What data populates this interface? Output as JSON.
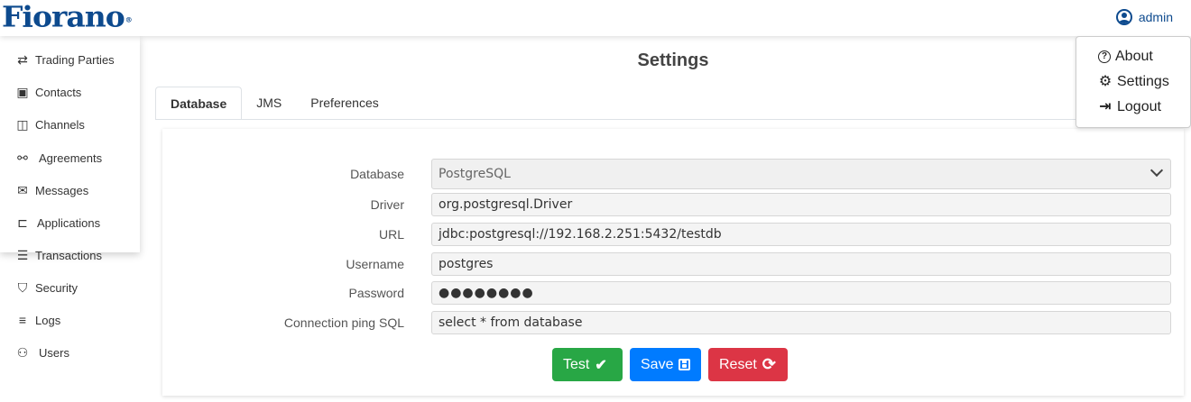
{
  "header": {
    "logo": "Fiorano",
    "logo_mark": "®",
    "user_label": "admin",
    "brand_color": "#0d4a8e"
  },
  "sidebar": {
    "items": [
      {
        "label": "Trading Parties",
        "icon": "arrows-exchange-icon",
        "glyph": "⇄"
      },
      {
        "label": "Contacts",
        "icon": "contact-card-icon",
        "glyph": "▣"
      },
      {
        "label": "Channels",
        "icon": "channel-icon",
        "glyph": "◫"
      },
      {
        "label": "Agreements",
        "icon": "handshake-icon",
        "glyph": "⚯"
      },
      {
        "label": "Messages",
        "icon": "envelope-icon",
        "glyph": "✉"
      },
      {
        "label": "Applications",
        "icon": "folder-open-icon",
        "glyph": "⊏"
      },
      {
        "label": "Transactions",
        "icon": "list-icon",
        "glyph": "☰"
      },
      {
        "label": "Security",
        "icon": "shield-icon",
        "glyph": "⛉"
      },
      {
        "label": "Logs",
        "icon": "bars-icon",
        "glyph": "≡"
      },
      {
        "label": "Users",
        "icon": "users-icon",
        "glyph": "⚇"
      }
    ]
  },
  "page": {
    "title": "Settings"
  },
  "tabs": [
    {
      "label": "Database",
      "active": true
    },
    {
      "label": "JMS",
      "active": false
    },
    {
      "label": "Preferences",
      "active": false
    }
  ],
  "form": {
    "database": {
      "label": "Database",
      "value": "PostgreSQL"
    },
    "driver": {
      "label": "Driver",
      "value": "org.postgresql.Driver"
    },
    "url": {
      "label": "URL",
      "value": "jdbc:postgresql://192.168.2.251:5432/testdb"
    },
    "username": {
      "label": "Username",
      "value": "postgres"
    },
    "password": {
      "label": "Password",
      "value": "●●●●●●●●"
    },
    "ping_sql": {
      "label": "Connection ping SQL",
      "value": "select * from database"
    }
  },
  "buttons": {
    "test": {
      "label": "Test",
      "glyph": "✔",
      "color": "#28a745"
    },
    "save": {
      "label": "Save",
      "glyph": "💾",
      "color": "#007bff"
    },
    "reset": {
      "label": "Reset",
      "glyph": "⟳",
      "color": "#dc3545"
    }
  },
  "dropdown": {
    "items": [
      {
        "label": "About",
        "icon": "question-circle-icon",
        "glyph": "?"
      },
      {
        "label": "Settings",
        "icon": "gear-icon",
        "glyph": "⚙"
      },
      {
        "label": "Logout",
        "icon": "sign-out-icon",
        "glyph": "⇥"
      }
    ]
  }
}
